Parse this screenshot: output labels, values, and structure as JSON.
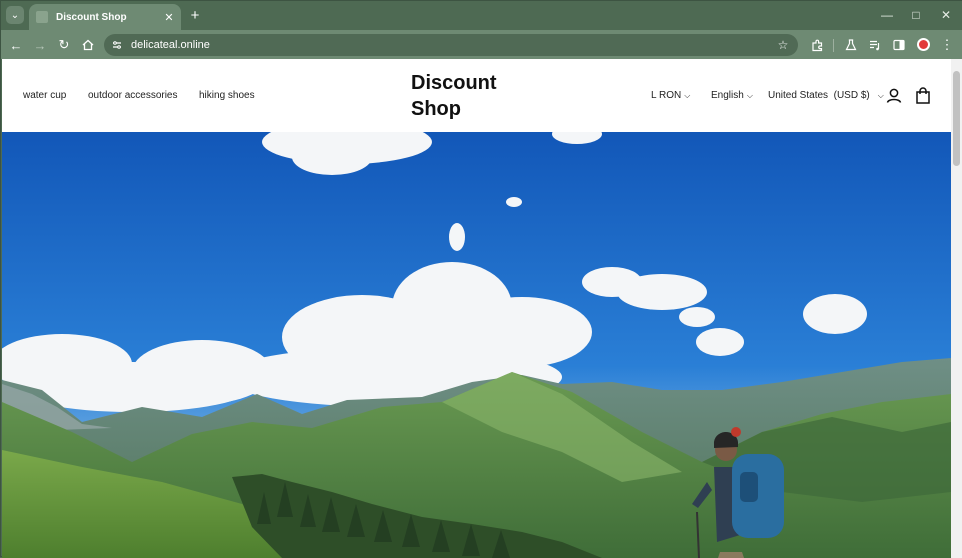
{
  "browser": {
    "tab_title": "Discount Shop",
    "url": "delicateal.online",
    "tab_search_icon": "chevron-down-icon",
    "new_tab_icon": "plus-icon"
  },
  "site": {
    "brand": "Discount Shop",
    "nav": [
      "water cup",
      "outdoor accessories",
      "hiking shoes"
    ],
    "currency": "L RON",
    "language": "English",
    "country": "United States",
    "country_currency": "(USD $)"
  },
  "hero": {
    "image": "mountain-hiker-landscape",
    "colors": {
      "sky": "#1f6cc4",
      "grass": "#5b8c3a",
      "mountain": "#4f7d4a"
    }
  }
}
